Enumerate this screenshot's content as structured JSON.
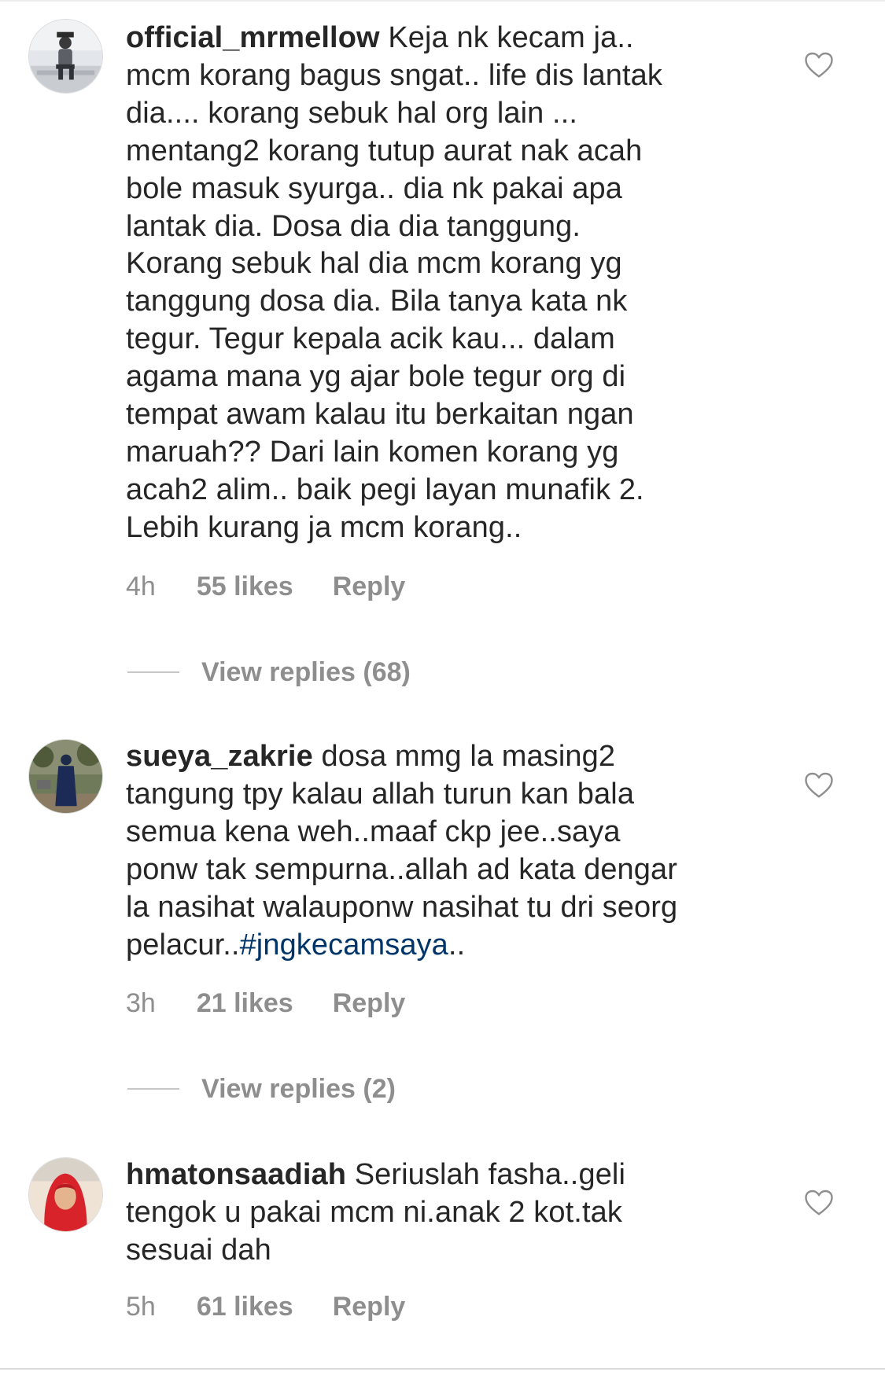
{
  "comments": [
    {
      "username": "official_mrmellow",
      "text_lines": [
        "Keja nk kecam ja..",
        "mcm korang bagus sngat.. life dis lantak",
        "dia.... korang sebuk hal org lain ...",
        "mentang2 korang tutup aurat nak acah",
        "bole masuk syurga.. dia nk pakai apa",
        "lantak dia. Dosa dia dia tanggung.",
        "Korang sebuk hal dia mcm korang yg",
        "tanggung dosa dia. Bila tanya kata nk",
        "tegur. Tegur kepala acik kau... dalam",
        "agama mana yg ajar bole tegur org di",
        "tempat awam kalau itu berkaitan ngan",
        "maruah?? Dari lain komen korang yg",
        "acah2 alim.. baik pegi layan munafik 2.",
        "Lebih kurang ja mcm korang.."
      ],
      "time": "4h",
      "likes": "55 likes",
      "reply_label": "Reply",
      "view_replies": "View replies (68)"
    },
    {
      "username": "sueya_zakrie",
      "text_lines": [
        "dosa mmg la masing2",
        "tangung tpy kalau allah turun kan bala",
        "semua kena weh..maaf ckp jee..saya",
        "ponw tak sempurna..allah ad kata dengar",
        "la nasihat walauponw nasihat tu dri seorg"
      ],
      "last_line_prefix": "pelacur..",
      "hashtag": "#jngkecamsaya",
      "last_line_suffix": "..",
      "time": "3h",
      "likes": "21 likes",
      "reply_label": "Reply",
      "view_replies": "View replies (2)"
    },
    {
      "username": "hmatonsaadiah",
      "text_lines": [
        "Seriuslah fasha..geli",
        "tengok u pakai mcm ni.anak 2 kot.tak",
        "sesuai dah"
      ],
      "time": "5h",
      "likes": "61 likes",
      "reply_label": "Reply"
    }
  ],
  "colors": {
    "text": "#262626",
    "meta": "#8e8e8e",
    "hashtag": "#003569",
    "heart_outline": "#8e8e8e"
  },
  "icons": {
    "like": "heart-outline-icon"
  }
}
